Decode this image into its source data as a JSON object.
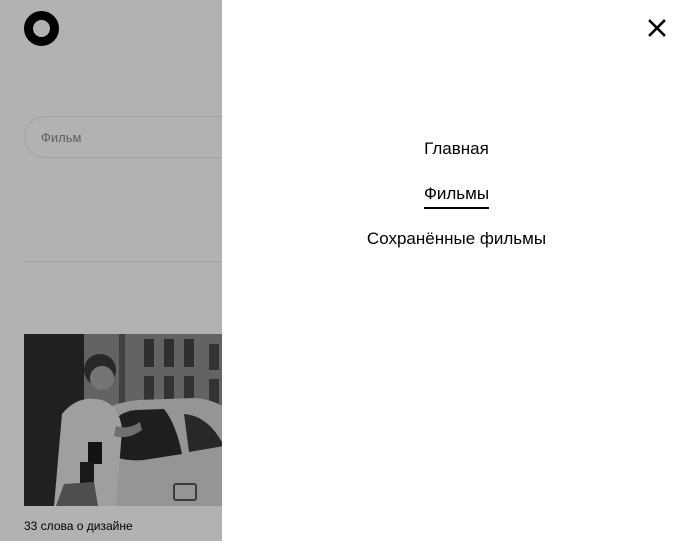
{
  "header": {
    "logo_icon": "ring-logo-icon"
  },
  "search": {
    "placeholder": "Фильм"
  },
  "cards": [
    {
      "title": "33 слова о дизайне",
      "image_icon": "photo-thumbnail"
    }
  ],
  "nav": {
    "close_icon": "close-icon",
    "items": [
      {
        "label": "Главная",
        "active": false
      },
      {
        "label": "Фильмы",
        "active": true
      },
      {
        "label": "Сохранённые фильмы",
        "active": false
      }
    ]
  },
  "colors": {
    "overlay": "#4d4d4d",
    "text": "#000000",
    "background": "#ffffff"
  }
}
